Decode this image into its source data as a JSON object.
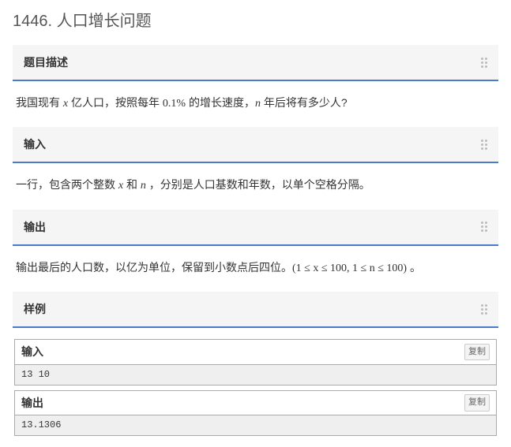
{
  "page": {
    "title": "1446. 人口增长问题"
  },
  "sections": {
    "description": {
      "header": "题目描述",
      "text_prefix": "我国现有 ",
      "var_x": "x",
      "text_mid1": " 亿人口，按照每年 ",
      "rate": "0.1%",
      "text_mid2": " 的增长速度，",
      "var_n": "n",
      "text_suffix": " 年后将有多少人?"
    },
    "input": {
      "header": "输入",
      "text_prefix": "一行，包含两个整数 ",
      "var_x": "x",
      "text_mid1": " 和 ",
      "var_n": "n",
      "text_suffix": " ，分别是人口基数和年数，以单个空格分隔。"
    },
    "output": {
      "header": "输出",
      "text_prefix": "输出最后的人口数，以亿为单位，保留到小数点后四位。",
      "constraint": "(1 ≤ x ≤ 100, 1 ≤ n ≤ 100)",
      "text_suffix": " 。"
    },
    "sample": {
      "header": "样例",
      "input_label": "输入",
      "output_label": "输出",
      "copy_label": "复制",
      "input_data": "13 10",
      "output_data": "13.1306"
    }
  }
}
